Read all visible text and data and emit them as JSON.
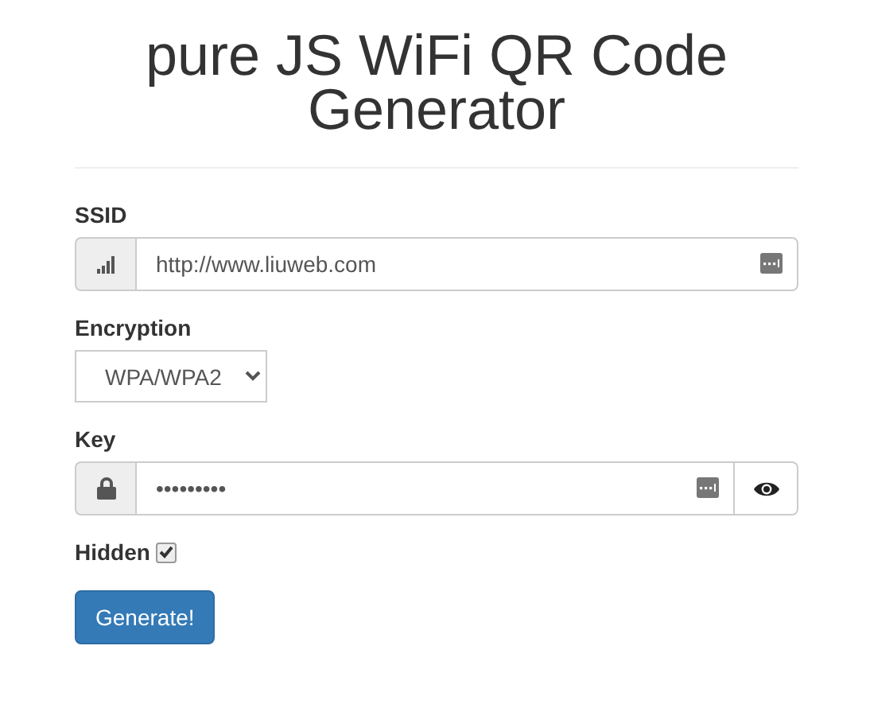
{
  "title": "pure JS WiFi QR Code Generator",
  "ssid": {
    "label": "SSID",
    "value": "http://www.liuweb.com"
  },
  "encryption": {
    "label": "Encryption",
    "value": "WPA/WPA2"
  },
  "key": {
    "label": "Key",
    "value": "•••••••••"
  },
  "hidden": {
    "label": "Hidden",
    "checked": true
  },
  "button": "Generate!"
}
